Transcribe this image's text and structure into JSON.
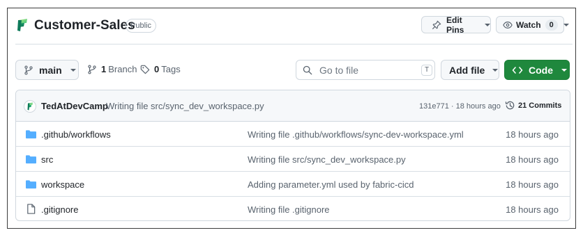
{
  "repo": {
    "name": "Customer-Sales",
    "visibility": "Public",
    "logo_icon": "fabric-logo-icon"
  },
  "header_actions": {
    "edit_pins_label": "Edit Pins",
    "watch_label": "Watch",
    "watch_count": "0"
  },
  "toolbar": {
    "branch": "main",
    "branch_count": "1",
    "branch_label": "Branch",
    "tag_count": "0",
    "tag_label": "Tags",
    "search_placeholder": "Go to file",
    "search_shortcut": "T",
    "add_file_label": "Add file",
    "code_label": "Code"
  },
  "latest_commit": {
    "author": "TedAtDevCamp",
    "message": "Writing file src/sync_dev_workspace.py",
    "meta": "131e771 · 18 hours ago",
    "commits_label": "21 Commits"
  },
  "files": [
    {
      "name": ".github/workflows",
      "type": "folder",
      "message": "Writing file .github/workflows/sync-dev-workspace.yml",
      "time": "18 hours ago"
    },
    {
      "name": "src",
      "type": "folder",
      "message": "Writing file src/sync_dev_workspace.py",
      "time": "18 hours ago"
    },
    {
      "name": "workspace",
      "type": "folder",
      "message": "Adding parameter.yml used by fabric-cicd",
      "time": "18 hours ago"
    },
    {
      "name": ".gitignore",
      "type": "file",
      "message": "Writing file .gitignore",
      "time": "18 hours ago"
    }
  ],
  "colors": {
    "primary_button": "#1f883d",
    "folder_icon": "#54aeff",
    "muted_text": "#59636e"
  }
}
